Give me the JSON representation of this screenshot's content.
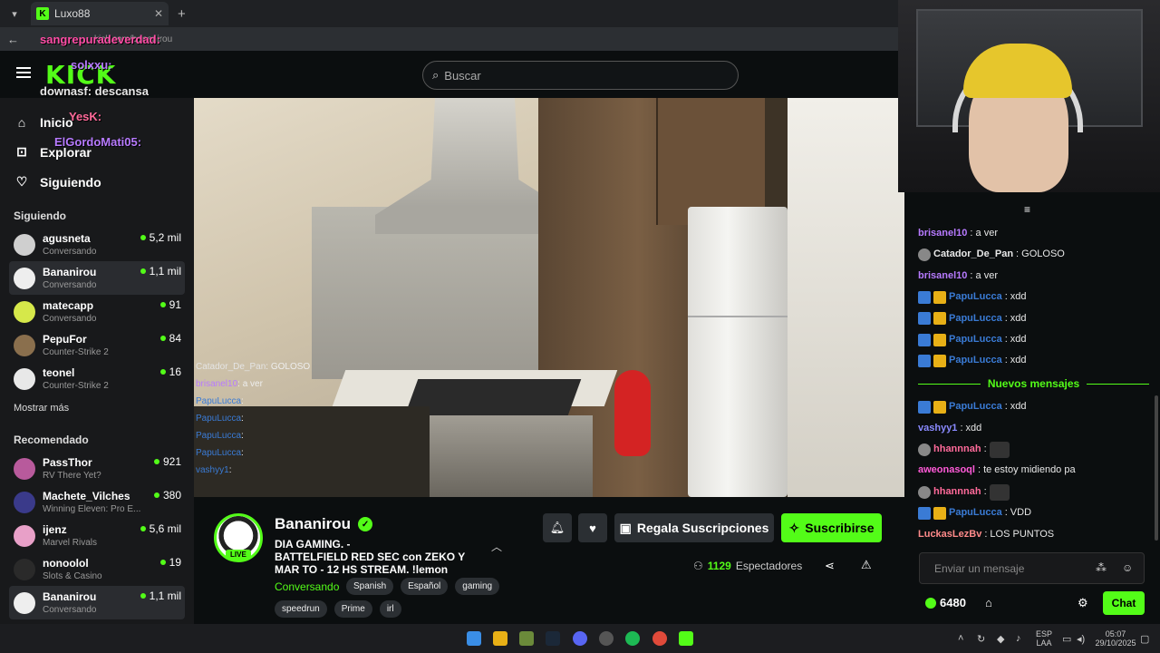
{
  "browser": {
    "tab_title": "Luxo88",
    "url": "kick.com/bananirou"
  },
  "header": {
    "logo": "KICK",
    "search_placeholder": "Buscar"
  },
  "overlays": {
    "o1": "sangrepuradeverdad:",
    "o2": "solxxu:",
    "o3": "downasf: descansa",
    "o4": "YesK:",
    "o5": "ElGordoMati05:"
  },
  "sidebar": {
    "nav": [
      {
        "label": "Inicio",
        "icon": "home-icon"
      },
      {
        "label": "Explorar",
        "icon": "compass-icon"
      },
      {
        "label": "Siguiendo",
        "icon": "heart-icon"
      }
    ],
    "following_title": "Siguiendo",
    "following": [
      {
        "name": "agusneta",
        "category": "Conversando",
        "viewers": "5,2 mil",
        "color": "#cfcfcf"
      },
      {
        "name": "Bananirou",
        "category": "Conversando",
        "viewers": "1,1 mil",
        "color": "#eeeeee"
      },
      {
        "name": "matecapp",
        "category": "Conversando",
        "viewers": "91",
        "color": "#d6e84a"
      },
      {
        "name": "PepuFor",
        "category": "Counter-Strike 2",
        "viewers": "84",
        "color": "#8a6f4d"
      },
      {
        "name": "teonel",
        "category": "Counter-Strike 2",
        "viewers": "16",
        "color": "#e8e8e8"
      }
    ],
    "show_more": "Mostrar más",
    "recommended_title": "Recomendado",
    "recommended": [
      {
        "name": "PassThor",
        "category": "RV There Yet?",
        "viewers": "921",
        "color": "#b85a9c"
      },
      {
        "name": "Machete_Vilches",
        "category": "Winning Eleven: Pro E...",
        "viewers": "380",
        "color": "#3a3a8a"
      },
      {
        "name": "ijenz",
        "category": "Marvel Rivals",
        "viewers": "5,6 mil",
        "color": "#e8a0c8"
      },
      {
        "name": "nonoolol",
        "category": "Slots & Casino",
        "viewers": "19",
        "color": "#2a2a2a"
      },
      {
        "name": "Bananirou",
        "category": "Conversando",
        "viewers": "1,1 mil",
        "color": "#eeeeee"
      }
    ]
  },
  "video_chat": [
    {
      "user": "Catador_De_Pan",
      "text": ": GOLOSO"
    },
    {
      "user": "brisanel10",
      "text": ": a ver"
    },
    {
      "user": "PapuLucca",
      "text": ":"
    },
    {
      "user": "PapuLucca",
      "text": ":"
    },
    {
      "user": "PapuLucca",
      "text": ":"
    },
    {
      "user": "PapuLucca",
      "text": ":"
    },
    {
      "user": "vashyy1",
      "text": ":"
    }
  ],
  "stream": {
    "name": "Bananirou",
    "live_label": "LIVE",
    "title": "DIA GAMING. -\n BATTELFIELD RED SEC con ZEKO Y MAR TO - 12 HS STREAM. !lemon",
    "category": "Conversando",
    "tags_row1": [
      "Spanish",
      "Español",
      "gaming"
    ],
    "tags_row2": [
      "speedrun",
      "Prime",
      "irl"
    ],
    "gift_label": "Regala Suscripciones",
    "subscribe_label": "Suscribirse",
    "viewers": "1129",
    "viewers_label": "Espectadores"
  },
  "chat": {
    "messages_before": [
      {
        "user": "brisanel10",
        "text": ": a ver",
        "color": "#b77aff",
        "badges": []
      },
      {
        "user": "Catador_De_Pan",
        "text": ": GOLOSO",
        "color": "#e8e8e8",
        "badges": [
          "bot"
        ]
      },
      {
        "user": "brisanel10",
        "text": ": a ver",
        "color": "#b77aff",
        "badges": []
      },
      {
        "user": "PapuLucca",
        "text": ": xdd",
        "color": "#3a7bd5",
        "badges": [
          "blue",
          "gold"
        ]
      },
      {
        "user": "PapuLucca",
        "text": ": xdd",
        "color": "#3a7bd5",
        "badges": [
          "blue",
          "gold"
        ]
      },
      {
        "user": "PapuLucca",
        "text": ": xdd",
        "color": "#3a7bd5",
        "badges": [
          "blue",
          "gold"
        ]
      },
      {
        "user": "PapuLucca",
        "text": ": xdd",
        "color": "#3a7bd5",
        "badges": [
          "blue",
          "gold"
        ]
      }
    ],
    "new_messages_label": "Nuevos mensajes",
    "messages_after": [
      {
        "user": "PapuLucca",
        "text": ": xdd",
        "color": "#3a7bd5",
        "badges": [
          "blue",
          "gold"
        ]
      },
      {
        "user": "vashyy1",
        "text": ": xdd",
        "color": "#8a8aff",
        "badges": []
      },
      {
        "user": "hhannnah",
        "text": ":",
        "color": "#ff6a9a",
        "badges": [
          "bot"
        ],
        "emote": true
      },
      {
        "user": "aweonasoql",
        "text": ": te estoy midiendo pa",
        "color": "#ff5ad8",
        "badges": []
      },
      {
        "user": "hhannnah",
        "text": ":",
        "color": "#ff6a9a",
        "badges": [
          "bot"
        ],
        "emote": true
      },
      {
        "user": "PapuLucca",
        "text": ": VDD",
        "color": "#3a7bd5",
        "badges": [
          "blue",
          "gold"
        ]
      },
      {
        "user": "LuckasLezBv",
        "text": ": LOS PUNTOS",
        "color": "#ff8a8a",
        "badges": []
      }
    ],
    "input_placeholder": "Enviar un mensaje",
    "points": "6480",
    "chat_button": "Chat"
  },
  "taskbar": {
    "lang": "ESP",
    "lang2": "LAA",
    "time": "05:07",
    "date": "29/10/2025"
  }
}
